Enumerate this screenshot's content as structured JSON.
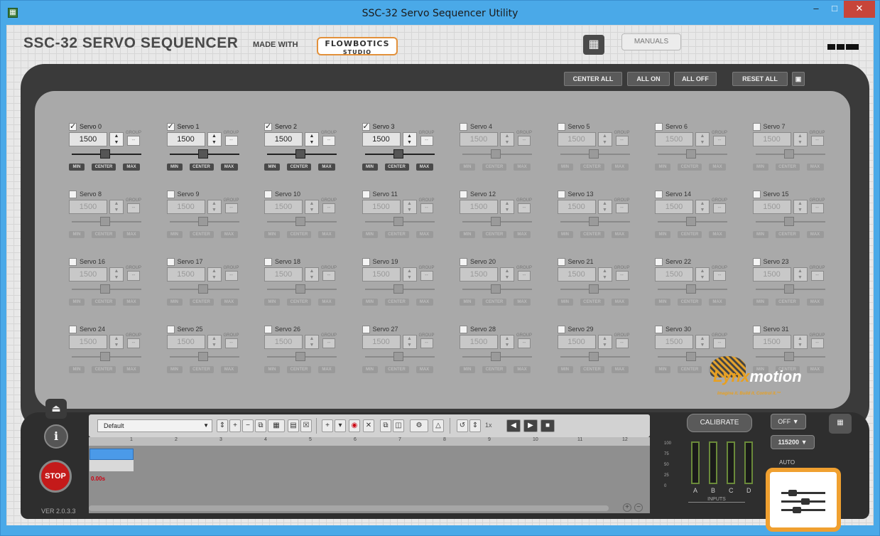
{
  "window": {
    "title": "SSC-32 Servo Sequencer Utility",
    "min": "–",
    "max": "□",
    "close": "✕"
  },
  "header": {
    "app_title": "SSC-32 SERVO SEQUENCER",
    "made_with": "MADE WITH",
    "flowbotics": "FLOWBOTICS",
    "flowbotics_sub": "STUDIO",
    "manuals": "MANUALS",
    "cart_icon": "▦"
  },
  "actions": {
    "center_all": "CENTER ALL",
    "all_on": "ALL ON",
    "all_off": "ALL OFF",
    "reset_all": "RESET ALL",
    "save_icon": "▣"
  },
  "servo_common": {
    "group_label": "GROUP",
    "group_value": "--",
    "min": "MIN",
    "center": "CENTER",
    "max": "MAX",
    "value": "1500"
  },
  "servos": [
    {
      "name": "Servo 0",
      "enabled": true
    },
    {
      "name": "Servo 1",
      "enabled": true
    },
    {
      "name": "Servo 2",
      "enabled": true
    },
    {
      "name": "Servo 3",
      "enabled": true
    },
    {
      "name": "Servo 4",
      "enabled": false
    },
    {
      "name": "Servo 5",
      "enabled": false
    },
    {
      "name": "Servo 6",
      "enabled": false
    },
    {
      "name": "Servo 7",
      "enabled": false
    },
    {
      "name": "Servo 8",
      "enabled": false
    },
    {
      "name": "Servo 9",
      "enabled": false
    },
    {
      "name": "Servo 10",
      "enabled": false
    },
    {
      "name": "Servo 11",
      "enabled": false
    },
    {
      "name": "Servo 12",
      "enabled": false
    },
    {
      "name": "Servo 13",
      "enabled": false
    },
    {
      "name": "Servo 14",
      "enabled": false
    },
    {
      "name": "Servo 15",
      "enabled": false
    },
    {
      "name": "Servo 16",
      "enabled": false
    },
    {
      "name": "Servo 17",
      "enabled": false
    },
    {
      "name": "Servo 18",
      "enabled": false
    },
    {
      "name": "Servo 19",
      "enabled": false
    },
    {
      "name": "Servo 20",
      "enabled": false
    },
    {
      "name": "Servo 21",
      "enabled": false
    },
    {
      "name": "Servo 22",
      "enabled": false
    },
    {
      "name": "Servo 23",
      "enabled": false
    },
    {
      "name": "Servo 24",
      "enabled": false
    },
    {
      "name": "Servo 25",
      "enabled": false
    },
    {
      "name": "Servo 26",
      "enabled": false
    },
    {
      "name": "Servo 27",
      "enabled": false
    },
    {
      "name": "Servo 28",
      "enabled": false
    },
    {
      "name": "Servo 29",
      "enabled": false
    },
    {
      "name": "Servo 30",
      "enabled": false
    },
    {
      "name": "Servo 31",
      "enabled": false
    }
  ],
  "sequencer": {
    "sequence_name": "Default",
    "speed": "1x",
    "ruler": [
      "1",
      "2",
      "3",
      "4",
      "5",
      "6",
      "7",
      "8",
      "9",
      "10",
      "11",
      "12"
    ],
    "time": "0.00s",
    "zoom_in": "+",
    "zoom_out": "−"
  },
  "left": {
    "eject_icon": "⏏",
    "info": "i",
    "stop": "STOP",
    "version": "VER 2.0.3.3"
  },
  "meters": {
    "scale": [
      "100",
      "75",
      "50",
      "25",
      "0"
    ],
    "channels": [
      "A",
      "B",
      "C",
      "D"
    ],
    "levels": [
      0.0,
      0.0,
      0.0,
      0.0
    ],
    "label": "INPUTS"
  },
  "connection": {
    "calibrate": "CALIBRATE",
    "port": "OFF",
    "baud": "115200",
    "auto": "AUTO"
  },
  "brand": {
    "lynx": "Lynx",
    "motion": "motion",
    "tagline": "Imagine it. Build it. Control it.™"
  }
}
